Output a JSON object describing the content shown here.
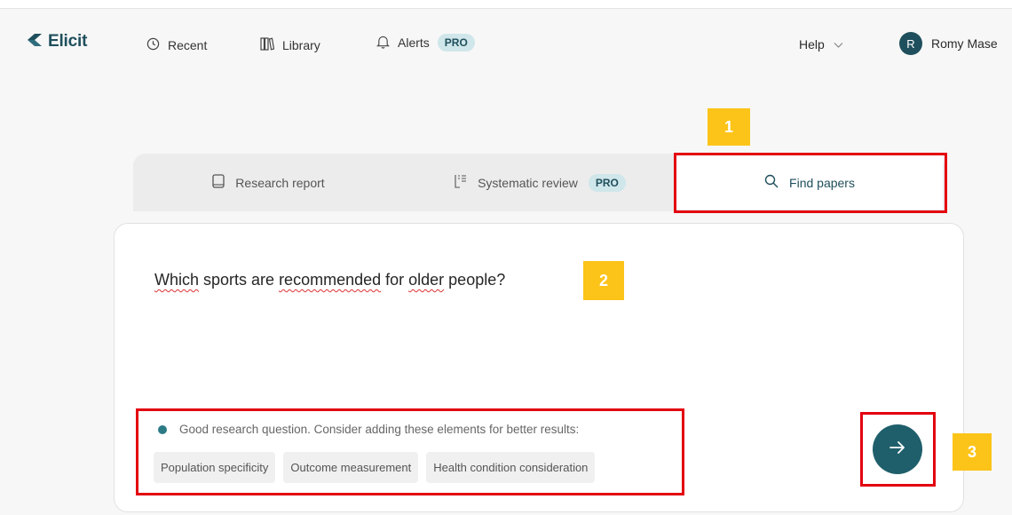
{
  "app": {
    "name": "Elicit"
  },
  "nav": {
    "recent": "Recent",
    "library": "Library",
    "alerts": "Alerts",
    "alerts_badge": "PRO",
    "help": "Help",
    "user_initial": "R",
    "user_name": "Romy Mase"
  },
  "annotations": {
    "one": "1",
    "two": "2",
    "three": "3"
  },
  "tabs": {
    "research_report": "Research report",
    "systematic_review": "Systematic review",
    "systematic_badge": "PRO",
    "find_papers": "Find papers"
  },
  "search": {
    "question_words": [
      "Which",
      " sports are ",
      "recommended",
      " for ",
      "older",
      " people?"
    ],
    "quality_message": "Good research question. Consider adding these elements for better results:",
    "suggestions": [
      "Population specificity",
      "Outcome measurement",
      "Health condition consideration"
    ]
  },
  "colors": {
    "brand": "#1f4f5c",
    "accent_button": "#1f5f6b",
    "annotation_yellow": "#fcc419",
    "highlight_red": "#e3000f"
  },
  "icons": {
    "logo": "elicit-logo-icon",
    "recent": "clock-icon",
    "library": "books-icon",
    "alerts": "bell-icon",
    "help": "chevron-down-icon",
    "research_report": "document-icon",
    "systematic_review": "list-icon",
    "find_papers": "search-icon",
    "submit": "arrow-right-icon"
  }
}
